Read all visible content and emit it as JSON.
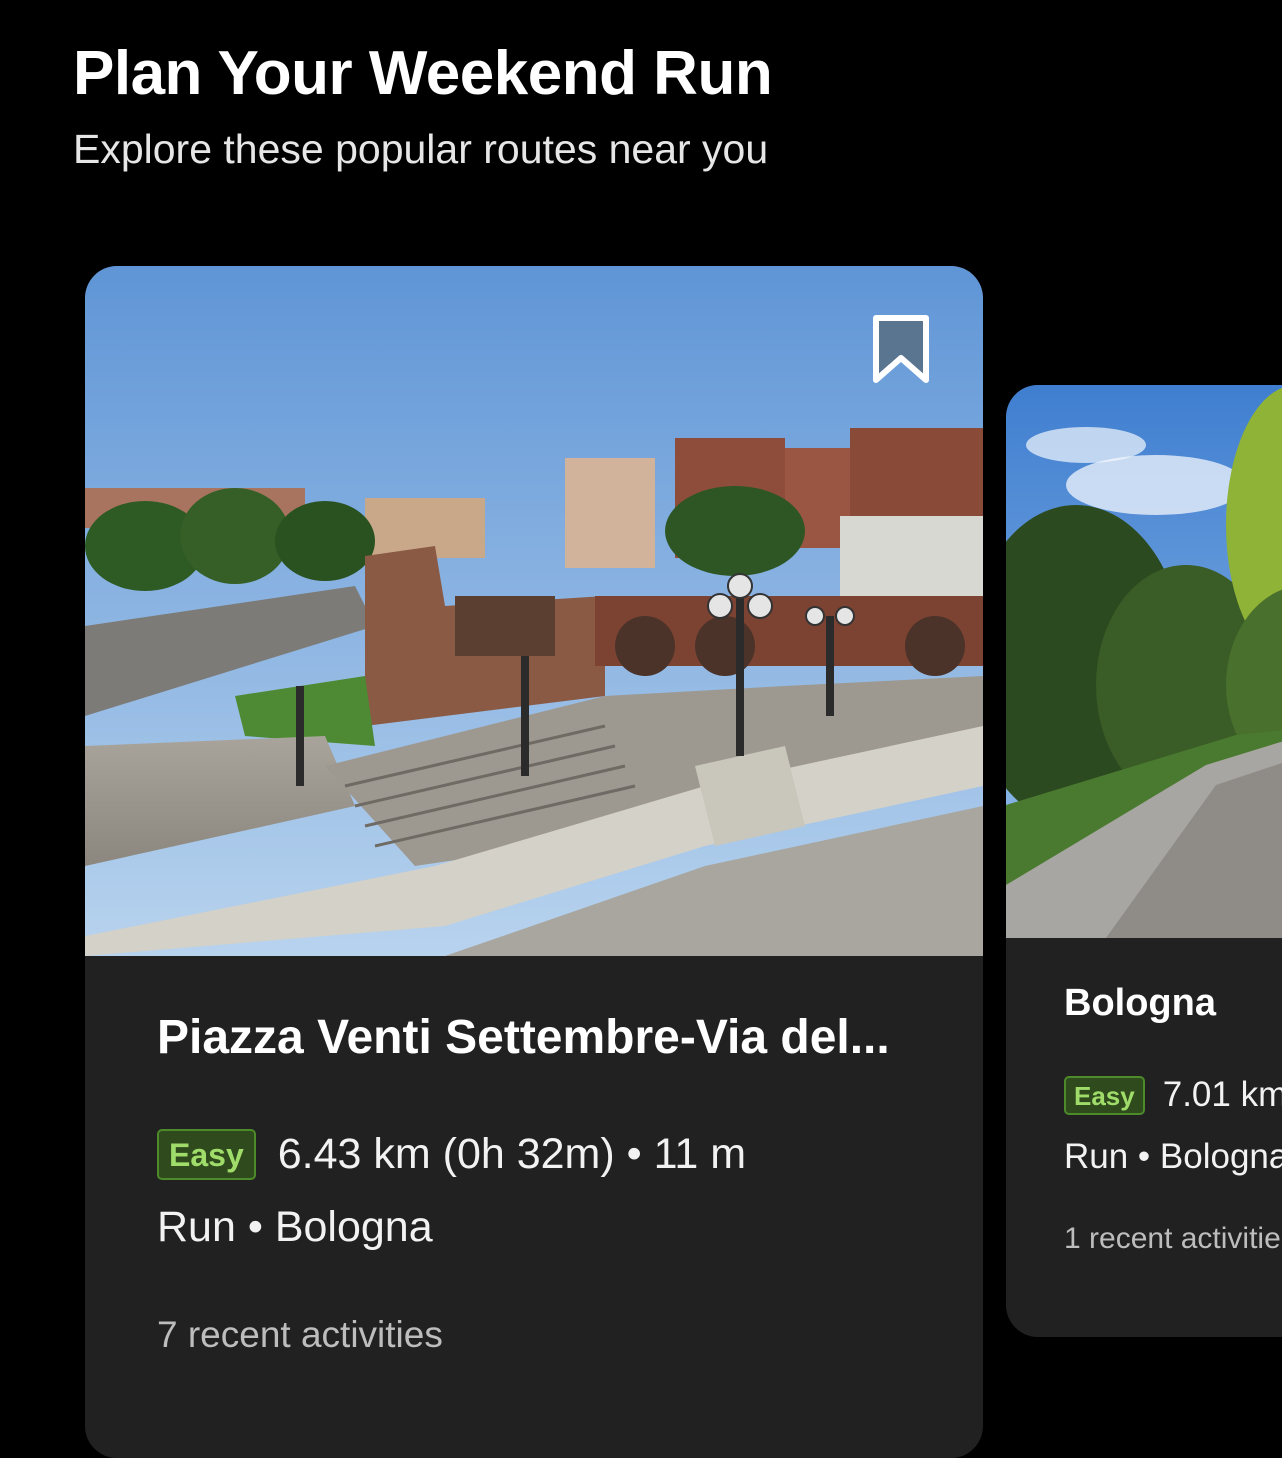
{
  "header": {
    "title": "Plan Your Weekend Run",
    "subtitle": "Explore these popular routes near you"
  },
  "routes": [
    {
      "title": "Piazza Venti Settembre-Via del...",
      "difficulty": "Easy",
      "stats": "6.43 km (0h 32m) • 11 m",
      "type_location": "Run • Bologna",
      "activities": "7 recent activities",
      "bookmark_icon": "bookmark-icon",
      "image_description_icon": "photo-stairs-square"
    },
    {
      "title": "Bologna",
      "difficulty": "Easy",
      "stats": "7.01 km",
      "type_location": "Run • Bologna",
      "activities": "1 recent activitie",
      "image_description_icon": "photo-park-path"
    }
  ],
  "colors": {
    "background": "#000000",
    "card": "#212121",
    "badge_bg": "#2f4a1c",
    "badge_border": "#4d8a2a",
    "badge_text": "#9fdc6a",
    "bookmark_fill": "#5a7590"
  }
}
